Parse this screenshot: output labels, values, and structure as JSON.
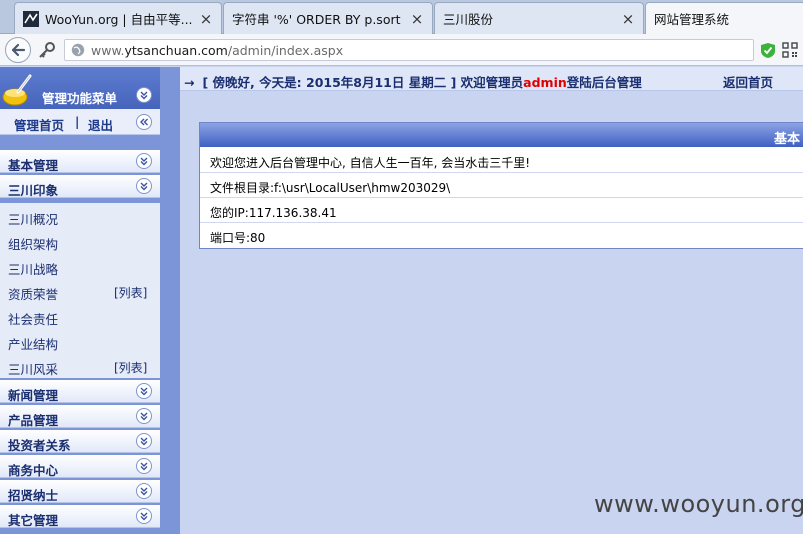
{
  "browser": {
    "tabs": [
      {
        "title": "WooYun.org | 自由平等...",
        "favicon": "wooyun-favicon"
      },
      {
        "title": "字符串 '%' ORDER BY p.sort ...",
        "favicon": "none"
      },
      {
        "title": "三川股份",
        "favicon": "none"
      },
      {
        "title": "网站管理系统",
        "favicon": "none",
        "active": true
      }
    ],
    "url_prefix": "www.",
    "url_domain": "ytsanchuan.com",
    "url_path": "/admin/index.aspx"
  },
  "sidebar": {
    "title": "管理功能菜单",
    "home_link": "管理首页",
    "separator": "|",
    "logout_link": "退出",
    "sections": [
      {
        "label": "基本管理"
      },
      {
        "label": "三川印象",
        "expanded": true
      },
      {
        "label": "新闻管理"
      },
      {
        "label": "产品管理"
      },
      {
        "label": "投资者关系"
      },
      {
        "label": "商务中心"
      },
      {
        "label": "招贤纳士"
      },
      {
        "label": "其它管理"
      }
    ],
    "sub_items": [
      {
        "label": "三川概况",
        "tag": ""
      },
      {
        "label": "组织架构",
        "tag": ""
      },
      {
        "label": "三川战略",
        "tag": ""
      },
      {
        "label": "资质荣誉",
        "tag": "[列表]"
      },
      {
        "label": "社会责任",
        "tag": ""
      },
      {
        "label": "产业结构",
        "tag": ""
      },
      {
        "label": "三川风采",
        "tag": "[列表]"
      }
    ]
  },
  "topbar": {
    "arrow": "→",
    "greeting_prefix": "[ 傍晚好, 今天是: 2015年8月11日 星期二 ] 欢迎管理员",
    "admin_name": "admin",
    "greeting_suffix": "登陆后台管理",
    "return_home": "返回首页"
  },
  "panel": {
    "title": "基本",
    "rows": [
      {
        "text": "欢迎您进入后台管理中心, 自信人生一百年, 会当水击三千里!"
      },
      {
        "text": "文件根目录:f:\\usr\\LocalUser\\hmw203029\\"
      },
      {
        "text": "您的IP:117.136.38.41"
      },
      {
        "text": "端口号:80"
      }
    ]
  },
  "watermark": "www.wooyun.org",
  "colors": {
    "menu_bg": "#7c95d8",
    "content_bg": "#c8d4f0",
    "panel_header": "#3f60c2",
    "admin_red": "#e00000"
  }
}
